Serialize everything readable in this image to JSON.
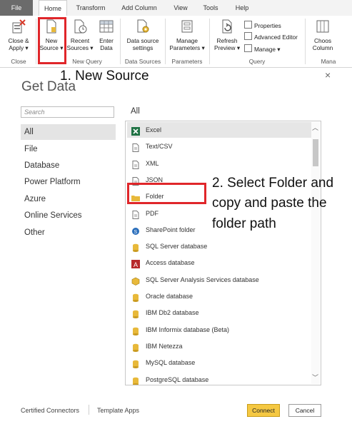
{
  "ribbon": {
    "tabs": [
      "File",
      "Home",
      "Transform",
      "Add Column",
      "View",
      "Tools",
      "Help"
    ],
    "active_tab": "Home",
    "buttons": {
      "close_apply": [
        "Close &",
        "Apply ▾"
      ],
      "new_source": [
        "New",
        "Source ▾"
      ],
      "recent_sources": [
        "Recent",
        "Sources ▾"
      ],
      "enter_data": [
        "Enter",
        "Data"
      ],
      "data_source_settings": [
        "Data source",
        "settings"
      ],
      "manage_parameters": [
        "Manage",
        "Parameters ▾"
      ],
      "refresh_preview": [
        "Refresh",
        "Preview ▾"
      ],
      "properties": "Properties",
      "advanced_editor": "Advanced Editor",
      "manage": "Manage ▾",
      "choose_columns": [
        "Choos",
        "Column"
      ]
    },
    "groups": [
      "Close",
      "New Query",
      "Data Sources",
      "Parameters",
      "Query",
      "Mana"
    ]
  },
  "annotations": {
    "step1": "1. New Source",
    "step2": [
      "2. Select Folder and",
      "copy and paste the",
      "folder path"
    ]
  },
  "dialog": {
    "title": "Get Data",
    "close": "×",
    "search_placeholder": "Search",
    "categories": [
      "All",
      "File",
      "Database",
      "Power Platform",
      "Azure",
      "Online Services",
      "Other"
    ],
    "selected_category": "All",
    "list_heading": "All",
    "items": [
      {
        "label": "Excel",
        "icon": "excel-icon",
        "color": "#1f7244"
      },
      {
        "label": "Text/CSV",
        "icon": "text-file-icon",
        "color": "#777777"
      },
      {
        "label": "XML",
        "icon": "xml-file-icon",
        "color": "#777777"
      },
      {
        "label": "JSON",
        "icon": "json-file-icon",
        "color": "#777777"
      },
      {
        "label": "Folder",
        "icon": "folder-icon",
        "color": "#e8b93a"
      },
      {
        "label": "PDF",
        "icon": "pdf-file-icon",
        "color": "#777777"
      },
      {
        "label": "SharePoint folder",
        "icon": "sharepoint-icon",
        "color": "#2a6ebb"
      },
      {
        "label": "SQL Server database",
        "icon": "database-icon",
        "color": "#e8b93a"
      },
      {
        "label": "Access database",
        "icon": "access-icon",
        "color": "#b7292b"
      },
      {
        "label": "SQL Server Analysis Services database",
        "icon": "cube-icon",
        "color": "#e8b93a"
      },
      {
        "label": "Oracle database",
        "icon": "database-icon",
        "color": "#e8b93a"
      },
      {
        "label": "IBM Db2 database",
        "icon": "database-icon",
        "color": "#e8b93a"
      },
      {
        "label": "IBM Informix database (Beta)",
        "icon": "database-icon",
        "color": "#e8b93a"
      },
      {
        "label": "IBM Netezza",
        "icon": "database-icon",
        "color": "#e8b93a"
      },
      {
        "label": "MySQL database",
        "icon": "database-icon",
        "color": "#e8b93a"
      },
      {
        "label": "PostgreSQL database",
        "icon": "database-icon",
        "color": "#e8b93a"
      }
    ],
    "footer": {
      "certified": "Certified Connectors",
      "template_apps": "Template Apps",
      "connect": "Connect",
      "cancel": "Cancel"
    }
  },
  "colors": {
    "highlight": "#e0262a",
    "connect": "#f5c842",
    "file_tab": "#6b6b6b"
  }
}
